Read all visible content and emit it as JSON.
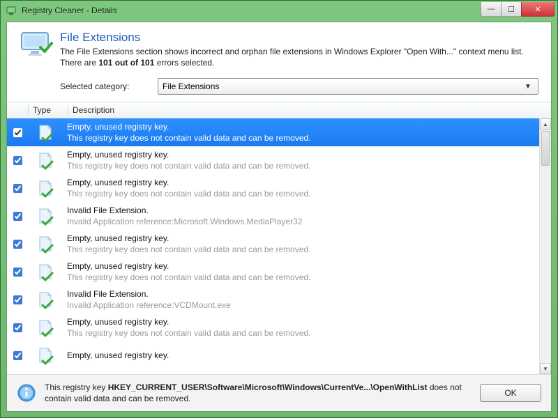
{
  "window": {
    "title": "Registry Cleaner - Details"
  },
  "header": {
    "heading": "File Extensions",
    "subtext_a": "The File Extensions section shows incorrect and orphan file extensions in Windows Explorer \"Open With...\" context menu list. There are ",
    "subtext_bold": "101 out of 101",
    "subtext_b": " errors selected."
  },
  "category": {
    "label": "Selected category:",
    "value": "File Extensions"
  },
  "columns": {
    "type": "Type",
    "description": "Description"
  },
  "rows": [
    {
      "checked": true,
      "selected": true,
      "l1": "Empty, unused registry key.",
      "l2": "This registry key does not contain valid data and can be removed."
    },
    {
      "checked": true,
      "selected": false,
      "l1": "Empty, unused registry key.",
      "l2": "This registry key does not contain valid data and can be removed."
    },
    {
      "checked": true,
      "selected": false,
      "l1": "Empty, unused registry key.",
      "l2": "This registry key does not contain valid data and can be removed."
    },
    {
      "checked": true,
      "selected": false,
      "l1": "Invalid File Extension.",
      "l2": "Invalid Application reference:Microsoft.Windows.MediaPlayer32"
    },
    {
      "checked": true,
      "selected": false,
      "l1": "Empty, unused registry key.",
      "l2": "This registry key does not contain valid data and can be removed."
    },
    {
      "checked": true,
      "selected": false,
      "l1": "Empty, unused registry key.",
      "l2": "This registry key does not contain valid data and can be removed."
    },
    {
      "checked": true,
      "selected": false,
      "l1": "Invalid File Extension.",
      "l2": "Invalid Application reference:VCDMount.exe"
    },
    {
      "checked": true,
      "selected": false,
      "l1": "Empty, unused registry key.",
      "l2": "This registry key does not contain valid data and can be removed."
    },
    {
      "checked": true,
      "selected": false,
      "l1": "Empty, unused registry key.",
      "l2": ""
    }
  ],
  "footer": {
    "prefix": "This registry key ",
    "bold": "HKEY_CURRENT_USER\\Software\\Microsoft\\Windows\\CurrentVe...\\OpenWithList",
    "suffix": " does not contain valid data and can be removed.",
    "ok": "OK"
  }
}
